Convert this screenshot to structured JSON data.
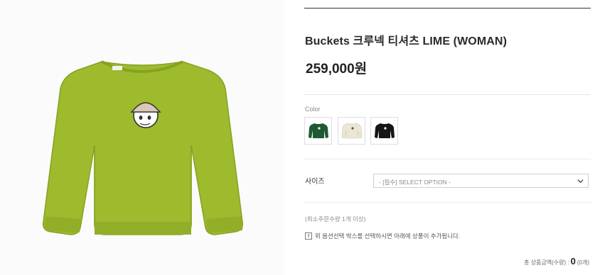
{
  "product": {
    "title": "Buckets 크루넥 티셔츠 LIME (WOMAN)",
    "price": "259,000원"
  },
  "color": {
    "label": "Color",
    "swatches": [
      {
        "name": "green",
        "hex": "#1d5a33"
      },
      {
        "name": "ivory",
        "hex": "#ece6d6"
      },
      {
        "name": "black",
        "hex": "#151515"
      }
    ]
  },
  "size": {
    "label": "사이즈",
    "select_value": "- [필수] SELECT OPTION -"
  },
  "notes": {
    "min_order": "(최소주문수량 1개 이상)",
    "info_icon_glyph": "!",
    "info_text": "위 옵션선택 박스를 선택하시면 아래에 상품이 추가됩니다."
  },
  "total": {
    "label": "총 상품금액(수량) :",
    "amount": "0",
    "qty": "(0개)"
  },
  "colors": {
    "lime": "#9dbb2d",
    "top_rule": "#333333"
  }
}
